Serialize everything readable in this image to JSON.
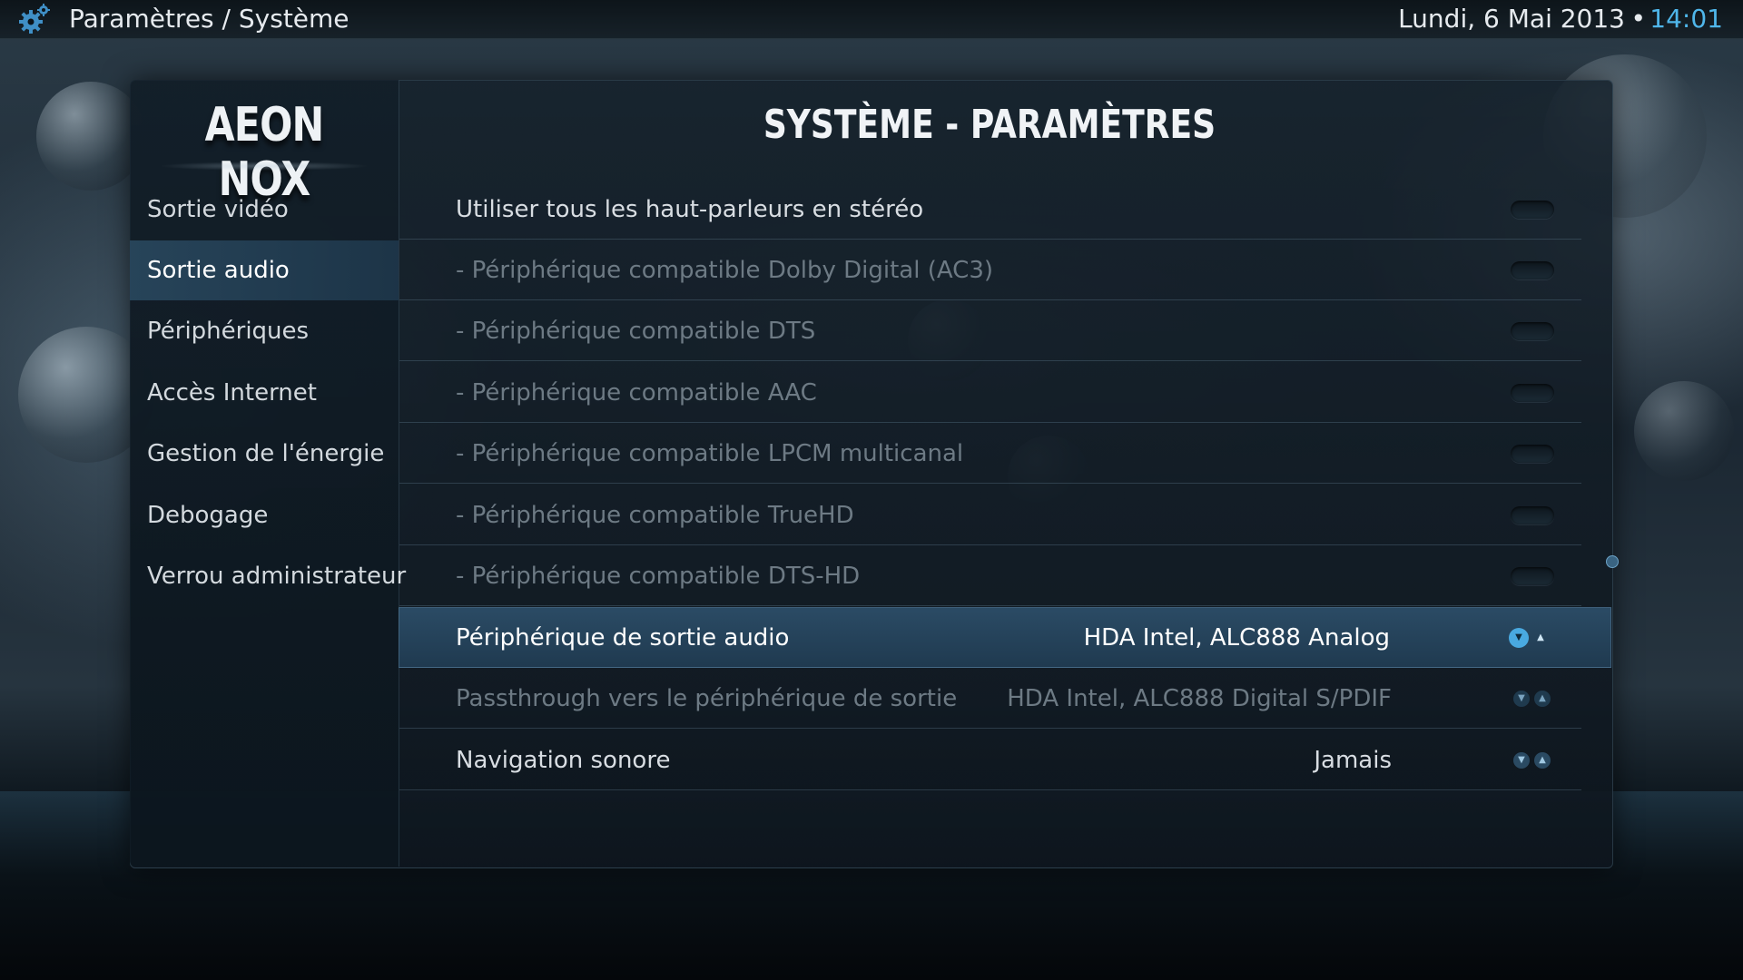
{
  "topbar": {
    "breadcrumb": "Paramètres / Système",
    "date": "Lundi, 6 Mai 2013",
    "separator": "•",
    "time": "14:01"
  },
  "logo": "AEON NOX",
  "page_title": "SYSTÈME - PARAMÈTRES",
  "sidebar": {
    "items": [
      {
        "label": "Sortie vidéo"
      },
      {
        "label": "Sortie audio",
        "active": true
      },
      {
        "label": "Périphériques"
      },
      {
        "label": "Accès Internet"
      },
      {
        "label": "Gestion de l'énergie"
      },
      {
        "label": "Debogage"
      },
      {
        "label": "Verrou administrateur"
      }
    ]
  },
  "settings": [
    {
      "label": "Utiliser tous les haut-parleurs en stéréo",
      "control": "toggle"
    },
    {
      "label": "- Périphérique compatible Dolby Digital (AC3)",
      "control": "toggle",
      "disabled": true
    },
    {
      "label": "- Périphérique compatible DTS",
      "control": "toggle",
      "disabled": true
    },
    {
      "label": "- Périphérique compatible AAC",
      "control": "toggle",
      "disabled": true
    },
    {
      "label": "- Périphérique compatible LPCM multicanal",
      "control": "toggle",
      "disabled": true
    },
    {
      "label": "- Périphérique compatible TrueHD",
      "control": "toggle",
      "disabled": true
    },
    {
      "label": "- Périphérique compatible DTS-HD",
      "control": "toggle",
      "disabled": true
    },
    {
      "label": "Périphérique de sortie audio",
      "value": "HDA Intel, ALC888 Analog",
      "control": "spinner",
      "focused": true
    },
    {
      "label": "Passthrough vers le périphérique de sortie",
      "value": "HDA Intel, ALC888 Digital S/PDIF",
      "control": "spinner",
      "disabled": true
    },
    {
      "label": "Navigation sonore",
      "value": "Jamais",
      "control": "spinner"
    }
  ],
  "colors": {
    "accent": "#4fb6ea",
    "focus_row": "#2c4e68",
    "panel": "#16222c"
  },
  "icons": {
    "topbar": "gear-icon",
    "spinner_down": "chevron-down-icon",
    "spinner_up": "chevron-up-icon"
  }
}
